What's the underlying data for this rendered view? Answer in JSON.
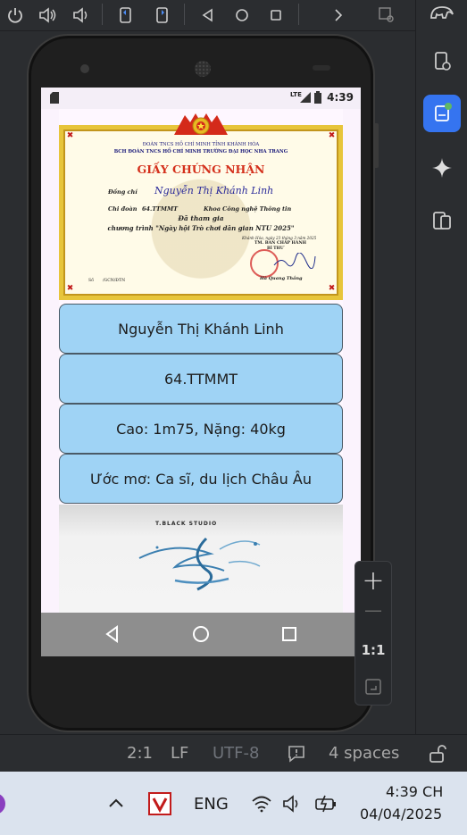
{
  "toolbar": {
    "icons": [
      "power-icon",
      "volume-up-icon",
      "volume-down-icon",
      "rotate-left-icon",
      "rotate-right-icon",
      "back-icon",
      "home-icon",
      "overview-icon",
      "more-icon",
      "snapshot-icon"
    ]
  },
  "right_strip": {
    "icons": [
      "gradle-elephant-icon",
      "device-manager-icon",
      "running-devices-icon",
      "gemini-icon",
      "device-mirroring-icon"
    ],
    "accent": "#3574f0"
  },
  "device": {
    "status_bar": {
      "network": "LTE",
      "time": "4:39"
    },
    "certificate": {
      "org_line_1": "ĐOÀN TNCS HỒ CHÍ MINH TỈNH KHÁNH HÒA",
      "org_line_2": "BCH ĐOÀN TNCS HỒ CHÍ MINH TRƯỜNG ĐẠI HỌC NHA TRANG",
      "title": "GIẤY CHỨNG NHẬN",
      "label_comrade": "Đồng chí",
      "name": "Nguyễn Thị Khánh Linh",
      "label_branch": "Chi đoàn",
      "branch": "64.TTMMT",
      "faculty": "Khoa Công nghệ Thông tin",
      "participated": "Đã tham gia",
      "program": "chương trình \"Ngày hội Trò chơi dân gian NTU 2025\"",
      "date": "Khánh Hòa, ngày 23 tháng 3 năm 2025",
      "on_behalf": "TM. BAN CHẤP HÀNH",
      "role": "BÍ THƯ",
      "signer": "Hà Quang Thắng",
      "number_label": "Số",
      "number_suffix": "/GCN/ĐTN"
    },
    "cards": [
      {
        "text": "Nguyễn Thị Khánh Linh"
      },
      {
        "text": "64.TTMMT"
      },
      {
        "text": "Cao: 1m75, Nặng: 40kg"
      },
      {
        "text": "Ước mơ: Ca sĩ, du lịch Châu Âu"
      }
    ],
    "painting_label": "T.BLACK STUDIO",
    "nav": {
      "back": "back-icon",
      "home": "home-icon",
      "recents": "recents-icon"
    }
  },
  "zoom": {
    "plus": "+",
    "minus": "—",
    "ratio": "1:1"
  },
  "ide_status": {
    "position": "2:1",
    "line_sep": "LF",
    "encoding": "UTF-8",
    "indent": "4 spaces"
  },
  "taskbar": {
    "language": "ENG",
    "time": "4:39 CH",
    "date": "04/04/2025"
  },
  "colors": {
    "card_bg": "#9fd3f5",
    "app_bg": "#fef7ff",
    "ide_bg": "#2b2d30",
    "taskbar_bg": "#dbe3ee"
  }
}
